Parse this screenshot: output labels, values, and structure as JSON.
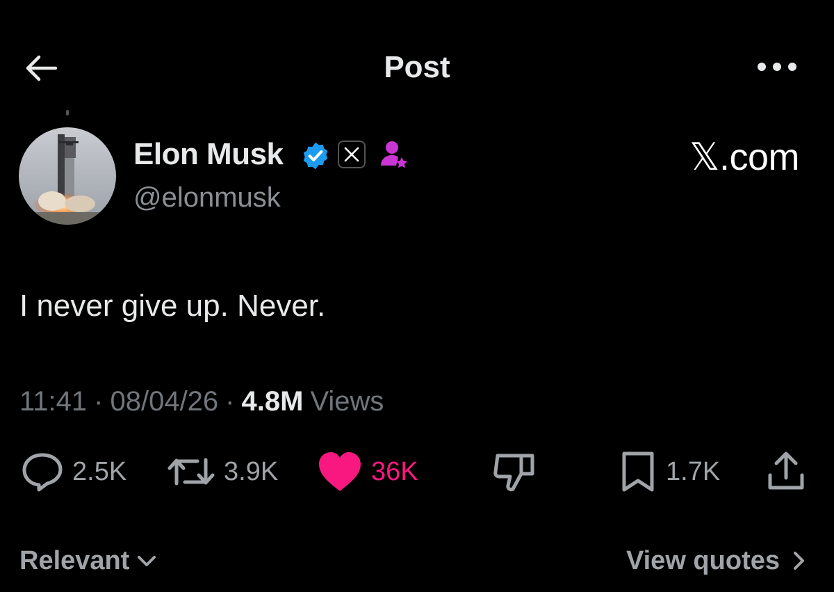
{
  "header": {
    "title": "Post",
    "back_icon": "arrow-left-icon",
    "more_icon": "more-horizontal-icon"
  },
  "author": {
    "name": "Elon Musk",
    "handle": "@elonmusk",
    "avatar": "rocket-launch-avatar",
    "badges": [
      "verified-icon",
      "x-affiliate-icon",
      "subscriber-icon"
    ],
    "brand": "𝕏.com"
  },
  "post": {
    "text": "I never give up. Never."
  },
  "meta": {
    "time": "11:41",
    "separator": "·",
    "date": "08/04/26",
    "views_count": "4.8M",
    "views_label": "Views"
  },
  "actions": {
    "replies": "2.5K",
    "reposts": "3.9K",
    "likes": "36K",
    "bookmarks": "1.7K"
  },
  "footer": {
    "sort_label": "Relevant",
    "quotes_label": "View quotes"
  },
  "colors": {
    "background": "#000000",
    "like": "#f91880",
    "verified": "#1d9bf0",
    "subscriber": "#c936d4",
    "muted": "#71767b"
  }
}
